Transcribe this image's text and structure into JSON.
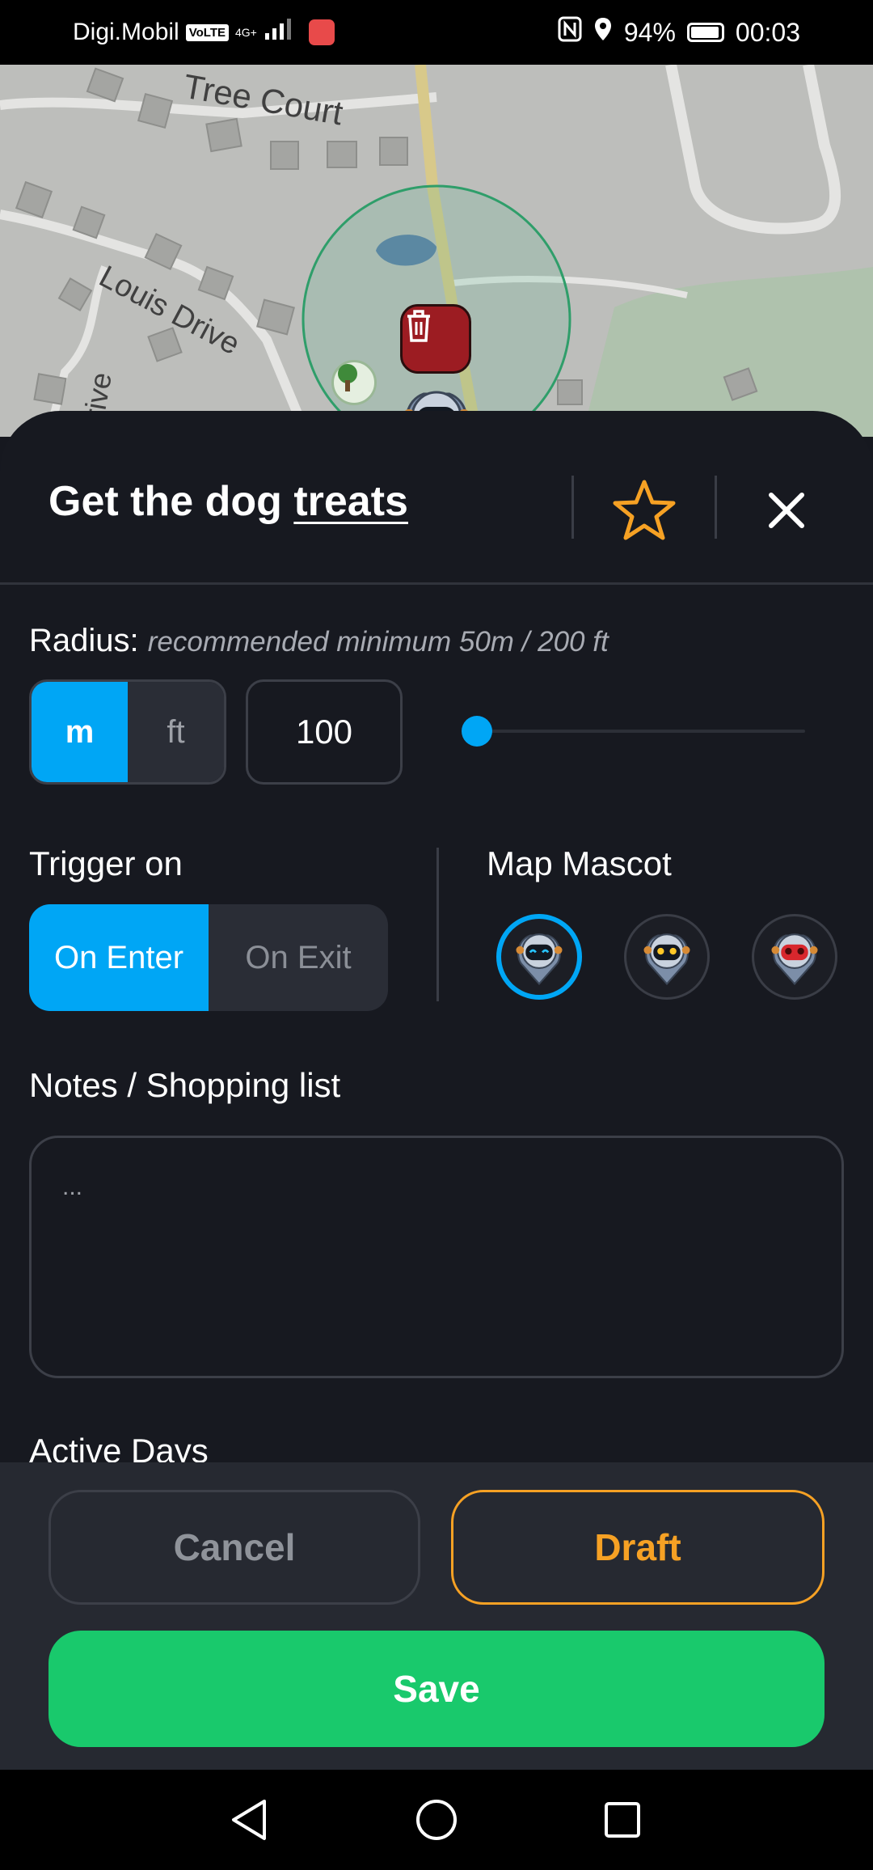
{
  "status_bar": {
    "carrier": "Digi.Mobil",
    "volte": "VoLTE",
    "network": "4G+",
    "battery": "94%",
    "time": "00:03"
  },
  "map": {
    "street_labels": [
      "Tree Court",
      "Louis Drive",
      "rive"
    ],
    "geofence_color": "#2f9e6a"
  },
  "sheet": {
    "title_plain": "Get the dog ",
    "title_underlined": "treats",
    "radius": {
      "label": "Radius:",
      "hint": "recommended minimum 50m / 200 ft",
      "units": [
        "m",
        "ft"
      ],
      "selected_unit": "m",
      "value": "100"
    },
    "trigger": {
      "label": "Trigger on",
      "options": [
        "On Enter",
        "On Exit"
      ],
      "selected": "On Enter"
    },
    "mascot": {
      "label": "Map Mascot",
      "options": [
        "mascot-blue",
        "mascot-yellow",
        "mascot-red"
      ],
      "selected": "mascot-blue"
    },
    "notes": {
      "label": "Notes / Shopping list",
      "placeholder": "..."
    },
    "active_days": {
      "label": "Active Days"
    }
  },
  "footer": {
    "cancel": "Cancel",
    "draft": "Draft",
    "save": "Save"
  },
  "colors": {
    "accent_blue": "#00a6f5",
    "accent_orange": "#f6a124",
    "save_green": "#19c96c",
    "delete_red": "#9c1c22"
  }
}
